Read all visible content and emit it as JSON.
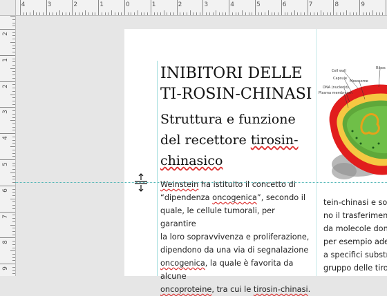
{
  "ruler": {
    "top_numbers": [
      "4",
      "3",
      "2",
      "1",
      "0",
      "1",
      "2",
      "3",
      "4",
      "5",
      "6",
      "7",
      "8",
      "9",
      "10",
      "11"
    ],
    "left_numbers": [
      "1",
      "2",
      "1",
      "2",
      "3",
      "4",
      "5",
      "6",
      "7",
      "8",
      "9"
    ]
  },
  "document": {
    "title": "INIBITORI DELLE TI-ROSIN-CHINASI",
    "subtitle": "Struttura e funzione del recettore tirosin-chinasico",
    "col1": [
      [
        "Weinstein",
        " ha istituito il concetto di"
      ],
      [
        "“dipendenza ",
        "oncogenica",
        "”, secondo il"
      ],
      [
        "quale, le cellule tumorali, per garantire"
      ],
      [
        "la loro sopravvivenza e proliferazione,"
      ],
      [
        "dipendono da una via di segnalazione"
      ],
      [
        "oncogenica",
        ", la quale è favorita da alcune"
      ],
      [
        "oncoproteine",
        ", tra cui le ",
        "tirosin-chinasi",
        "."
      ]
    ],
    "col2": [
      "tein-chinasi e son",
      "no il trasferiment",
      "da molecole dona",
      "per esempio ade",
      "a specifici substra",
      "gruppo delle tiro"
    ]
  },
  "figure": {
    "labels": [
      "Cell wall",
      "Capsule",
      "Mesosome",
      "DNA (nucleoid)",
      "Plasma membrane",
      "Ribos"
    ]
  },
  "colors": {
    "guide": "#9fdcdc",
    "spell_underline": "#d33"
  }
}
